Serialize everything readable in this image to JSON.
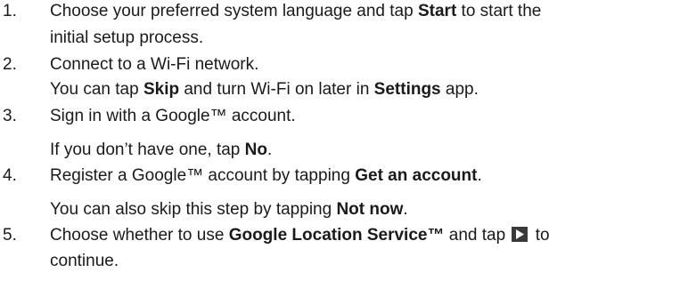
{
  "steps": [
    {
      "number": "1.",
      "line1_a": "Choose your preferred system language and tap ",
      "line1_b": "Start",
      "line1_c": " to start the",
      "line2": "initial setup process."
    },
    {
      "number": "2.",
      "line1": "Connect to a Wi-Fi network.",
      "line2_a": "You can tap ",
      "line2_b": "Skip",
      "line2_c": " and turn Wi-Fi on later in ",
      "line2_d": "Settings",
      "line2_e": " app."
    },
    {
      "number": "3.",
      "line1": "Sign in with a Google™ account.",
      "line2_a": "If you don’t have one, tap ",
      "line2_b": "No",
      "line2_c": "."
    },
    {
      "number": "4.",
      "line1_a": "Register a Google™ account by tapping ",
      "line1_b": "Get an account",
      "line1_c": ".",
      "line2_a": "You can also skip this step by tapping ",
      "line2_b": "Not now",
      "line2_c": "."
    },
    {
      "number": "5.",
      "line1_a": "Choose whether to use ",
      "line1_b": "Google Location Service™",
      "line1_c": " and tap ",
      "line1_icon": "play-arrow-icon",
      "line1_d": " to",
      "line2": "continue."
    }
  ]
}
